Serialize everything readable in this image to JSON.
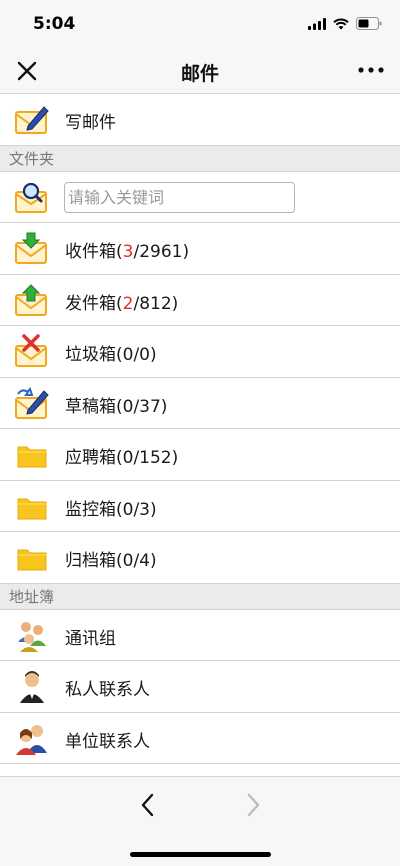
{
  "status": {
    "time": "5:04"
  },
  "nav": {
    "title": "邮件"
  },
  "compose": {
    "label": "写邮件"
  },
  "sections": {
    "folders": "文件夹",
    "address_book": "地址簿"
  },
  "search": {
    "placeholder": "请输入关键词"
  },
  "folders": [
    {
      "name": "收件箱(",
      "unread": "3",
      "rest": "/2961)",
      "icon": "inbox-icon"
    },
    {
      "name": "发件箱(",
      "unread": "2",
      "rest": "/812)",
      "icon": "outbox-icon"
    },
    {
      "name": "垃圾箱(0/0)",
      "icon": "trash-mail-icon"
    },
    {
      "name": "草稿箱(0/37)",
      "icon": "drafts-icon"
    },
    {
      "name": "应聘箱(0/152)",
      "icon": "folder-icon"
    },
    {
      "name": "监控箱(0/3)",
      "icon": "folder-icon"
    },
    {
      "name": "归档箱(0/4)",
      "icon": "folder-icon"
    }
  ],
  "contacts": [
    {
      "name": "通讯组",
      "icon": "group-icon"
    },
    {
      "name": "私人联系人",
      "icon": "person-icon"
    },
    {
      "name": "单位联系人",
      "icon": "company-contacts-icon"
    }
  ],
  "colors": {
    "accent_red": "#e0302a",
    "envelope": "#f5b731",
    "folder": "#f7c51e"
  }
}
